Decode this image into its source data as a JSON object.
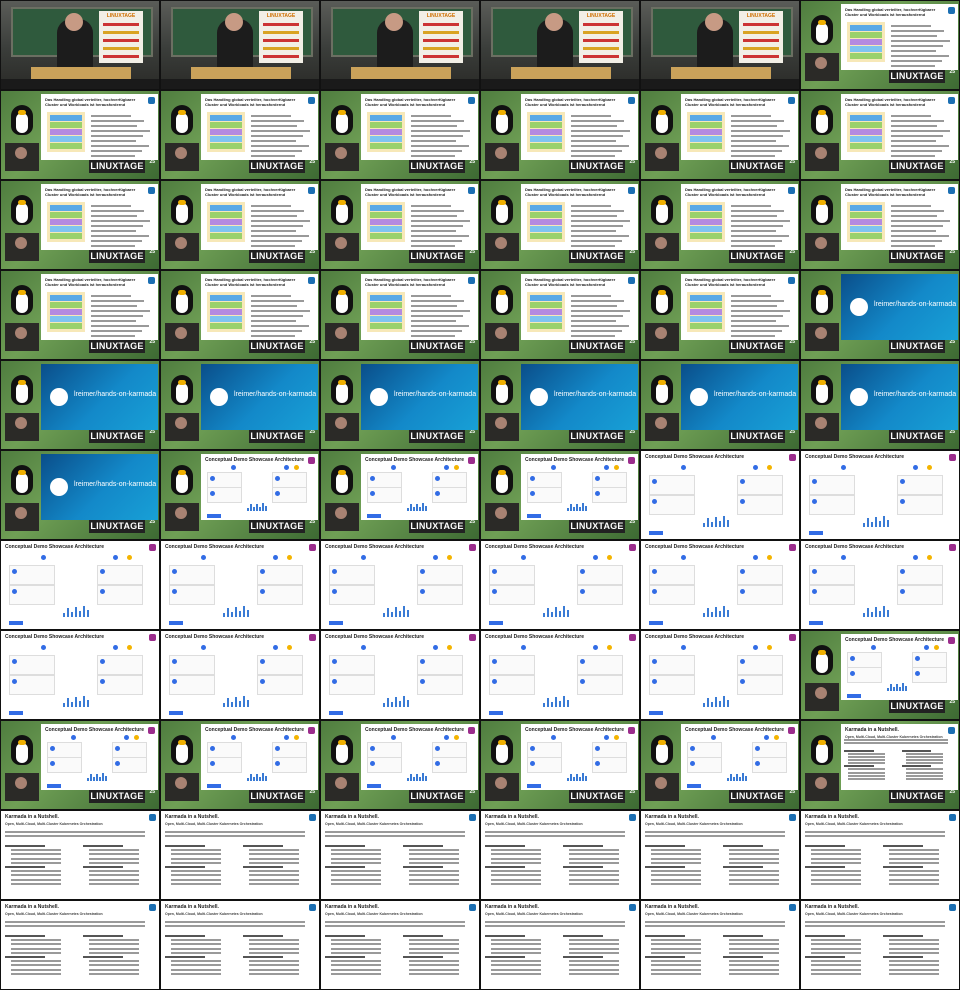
{
  "grid": {
    "columns": 6,
    "rows": 11
  },
  "stage_poster_title": "LINUXTAGE",
  "conference_logo": "LINUXTAGE",
  "conference_year": "25",
  "slides": {
    "cluster": {
      "title": "Das Handling global verteilter, hochverfügbarer Cluster und Workloads ist herausfordernd"
    },
    "github": {
      "text": "lreimer/hands-on-karmada"
    },
    "arch": {
      "title": "Conceptual Demo Showcase Architecture"
    },
    "karmada": {
      "title": "Karmada in a Nutshell.",
      "subtitle": "Open, Multi-Cloud, Multi-Cluster Kubernetes Orchestration"
    }
  },
  "tiles": [
    "stage",
    "stage",
    "stage",
    "stage",
    "stage",
    "conf-cluster",
    "conf-cluster",
    "conf-cluster",
    "conf-cluster",
    "conf-cluster",
    "conf-cluster",
    "conf-cluster",
    "conf-cluster",
    "conf-cluster",
    "conf-cluster",
    "conf-cluster",
    "conf-cluster",
    "conf-cluster",
    "conf-cluster",
    "conf-cluster",
    "conf-cluster",
    "conf-cluster",
    "conf-cluster",
    "conf-github",
    "conf-github",
    "conf-github",
    "conf-github",
    "conf-github",
    "conf-github",
    "conf-github",
    "conf-github",
    "conf-arch",
    "conf-arch",
    "conf-arch",
    "full-arch",
    "full-arch",
    "full-arch",
    "full-arch",
    "full-arch",
    "full-arch",
    "full-arch",
    "full-arch",
    "full-arch",
    "full-arch",
    "full-arch",
    "full-arch",
    "full-arch",
    "conf-arch",
    "conf-arch",
    "conf-arch",
    "conf-arch",
    "conf-arch",
    "conf-arch",
    "conf-karmada",
    "full-karmada",
    "full-karmada",
    "full-karmada",
    "full-karmada",
    "full-karmada",
    "full-karmada",
    "full-karmada",
    "full-karmada",
    "full-karmada",
    "full-karmada",
    "full-karmada",
    "full-karmada"
  ]
}
